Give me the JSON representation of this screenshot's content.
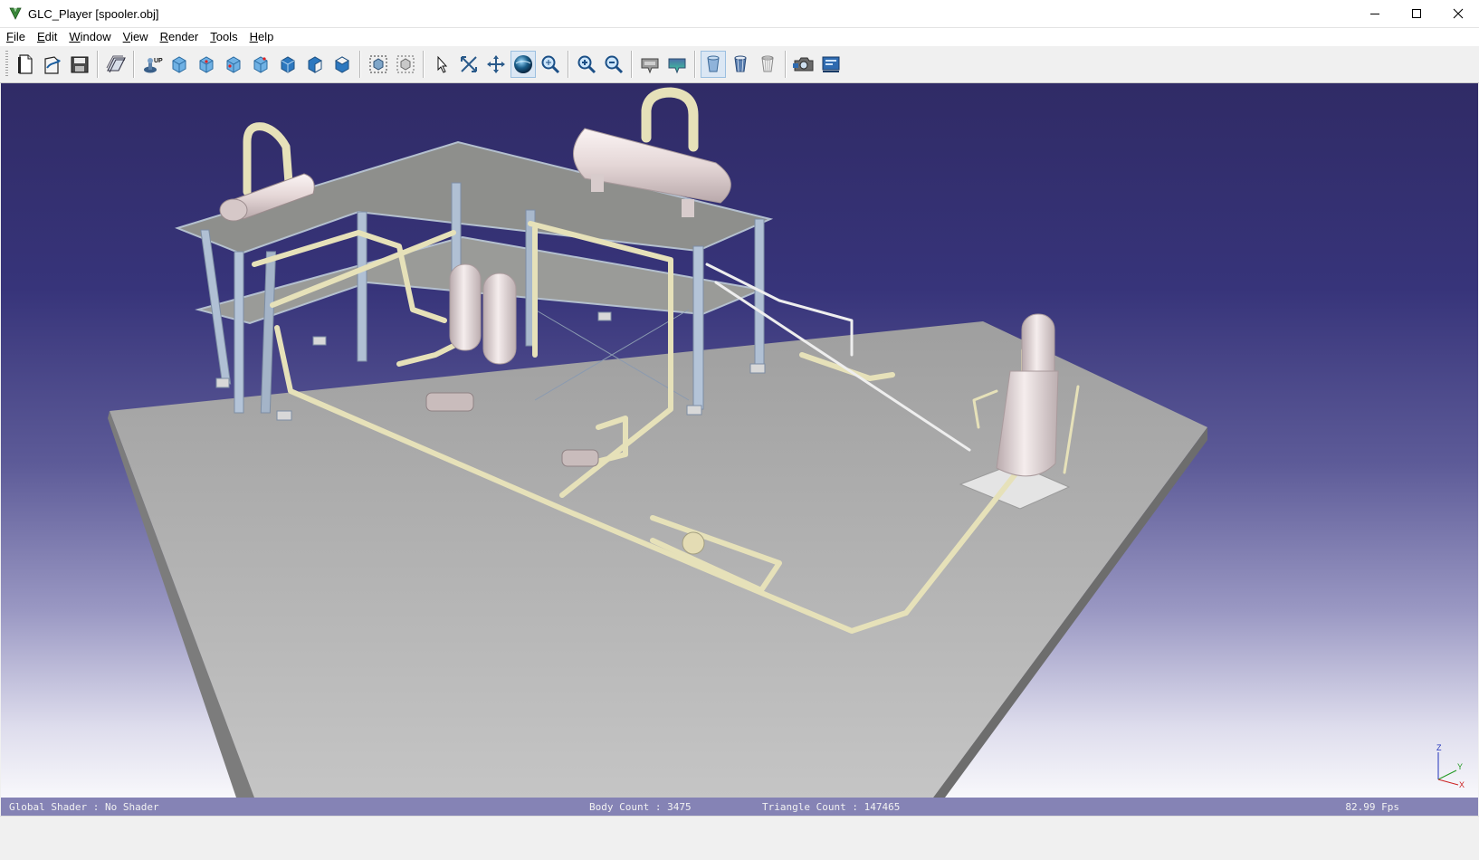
{
  "window": {
    "title": "GLC_Player [spooler.obj]",
    "controls": [
      "minimize-icon",
      "maximize-icon",
      "close-icon"
    ]
  },
  "menu": {
    "file": {
      "accel": "F",
      "rest": "ile"
    },
    "edit": {
      "accel": "E",
      "rest": "dit"
    },
    "window": {
      "accel": "W",
      "rest": "indow"
    },
    "view": {
      "accel": "V",
      "rest": "iew"
    },
    "render": {
      "accel": "R",
      "rest": "ender"
    },
    "tools": {
      "accel": "T",
      "rest": "ools"
    },
    "help": {
      "accel": "H",
      "rest": "elp"
    }
  },
  "toolbar": {
    "groups": [
      [
        "new-file-icon",
        "open-file-icon",
        "save-file-icon"
      ],
      [
        "open-album-icon"
      ],
      [
        "up-vector-icon",
        "view-iso-icon",
        "view-front-icon",
        "view-left-icon",
        "view-right-icon",
        "view-top-icon",
        "view-bottom-icon",
        "view-back-icon"
      ],
      [
        "fit-all-icon",
        "fit-selection-icon"
      ],
      [
        "select-arrow-icon",
        "zoom-window-icon",
        "pan-icon",
        "orbit-icon",
        "zoom-icon",
        "zoom-in-icon",
        "zoom-out-icon"
      ],
      [
        "camera-properties-icon",
        "background-icon"
      ],
      [
        "solid-mode-icon",
        "wireframe-mode-icon",
        "transparent-mode-icon"
      ],
      [
        "snapshot-icon",
        "slideshow-icon"
      ]
    ],
    "active": [
      "orbit-icon",
      "solid-mode-icon"
    ]
  },
  "viewport": {
    "background_top": "#302b66",
    "background_bottom": "#ffffff",
    "floor_color": "#b5b5b5",
    "pipe_color": "#e6e1b9",
    "steel_color": "#a9b8cc",
    "vessel_color": "#e8dcdc",
    "axis": {
      "z": "Z",
      "y": "Y",
      "x": "X"
    }
  },
  "infobar": {
    "shader": "Global Shader : No Shader",
    "body_count": "Body Count : 3475",
    "triangle_count": "Triangle Count : 147465",
    "fps": "82.99 Fps"
  }
}
